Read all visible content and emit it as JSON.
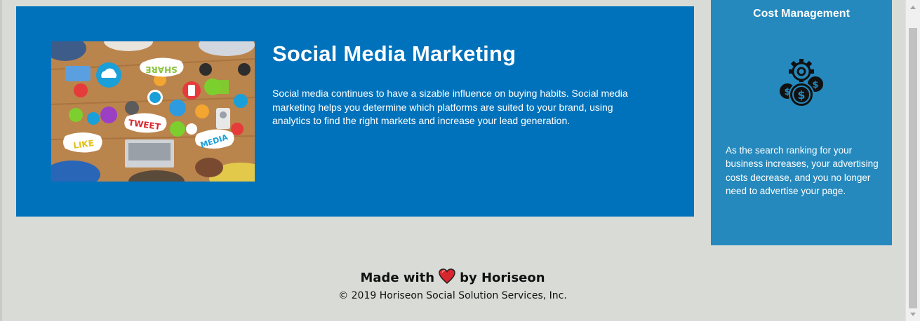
{
  "service": {
    "heading": "Social Media Marketing",
    "text": "Social media continues to have a sizable influence on buying habits. Social media marketing helps you determine which platforms are suited to your brand, using analytics to find the right markets and increase your lead generation.",
    "image_words": {
      "share": "SHARE",
      "tweet": "TWEET",
      "like": "LIKE",
      "media": "MEDIA"
    }
  },
  "benefit": {
    "title": "Cost Management",
    "text": "As the search ranking for your business increases, your advertising costs decrease, and you no longer need to advertise your page."
  },
  "footer": {
    "made_prefix": "Made with",
    "made_suffix": "by Horiseon",
    "copyright": "© 2019 Horiseon Social Solution Services, Inc."
  },
  "colors": {
    "page_background": "#d9dbd7",
    "service_background": "#0072bb",
    "benefit_background": "#2589bd",
    "heart": "#d8262e"
  },
  "icons": {
    "benefit": "cost-management-icon",
    "heart": "heart-icon"
  }
}
